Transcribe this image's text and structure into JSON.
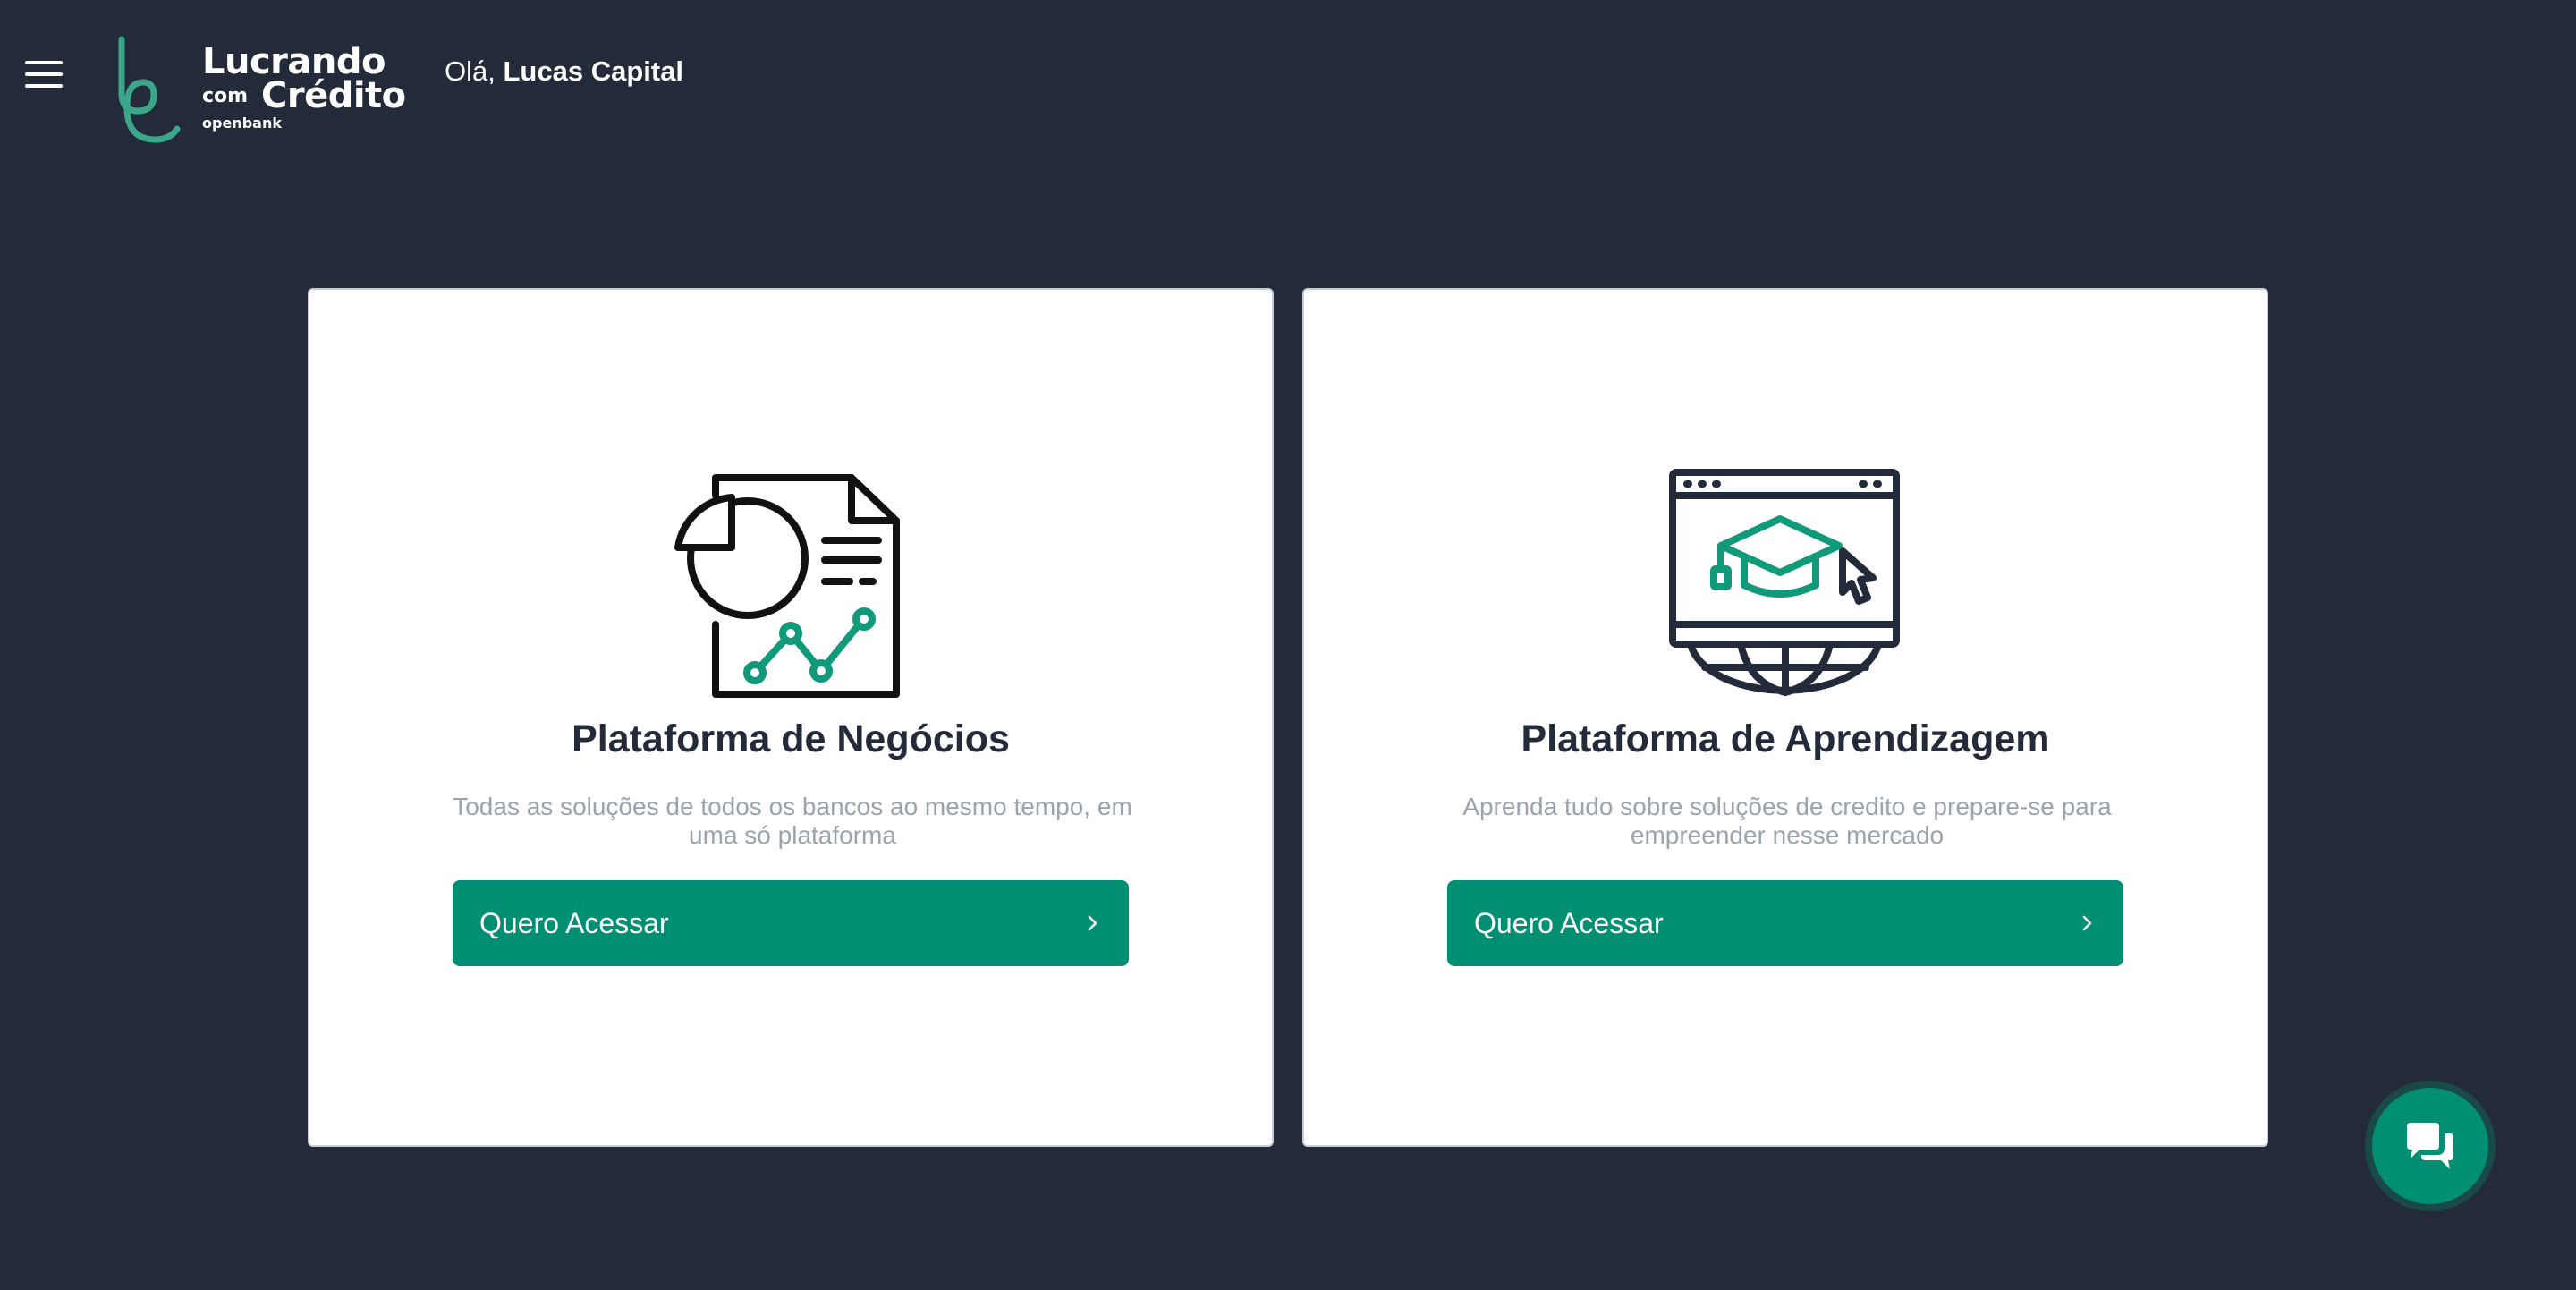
{
  "header": {
    "logo": {
      "line1": "Lucrando",
      "com": "com",
      "line2": "Crédito",
      "sub": "openbank"
    },
    "greeting_prefix": "Olá,",
    "user_name": "Lucas Capital"
  },
  "cards": [
    {
      "icon": "business-report-icon",
      "title": "Plataforma de Negócios",
      "description": "Todas as soluções de todos os bancos ao mesmo tempo, em uma só plataforma",
      "button_label": "Quero Acessar"
    },
    {
      "icon": "online-education-icon",
      "title": "Plataforma de Aprendizagem",
      "description": "Aprenda tudo sobre soluções de credito e prepare-se para empreender nesse mercado",
      "button_label": "Quero Acessar"
    }
  ],
  "chat": {
    "icon": "chat-icon"
  },
  "colors": {
    "background": "#232b3b",
    "accent": "#018f73",
    "card": "#ffffff",
    "text_dark": "#232b3b",
    "text_muted": "#9ba3af"
  }
}
